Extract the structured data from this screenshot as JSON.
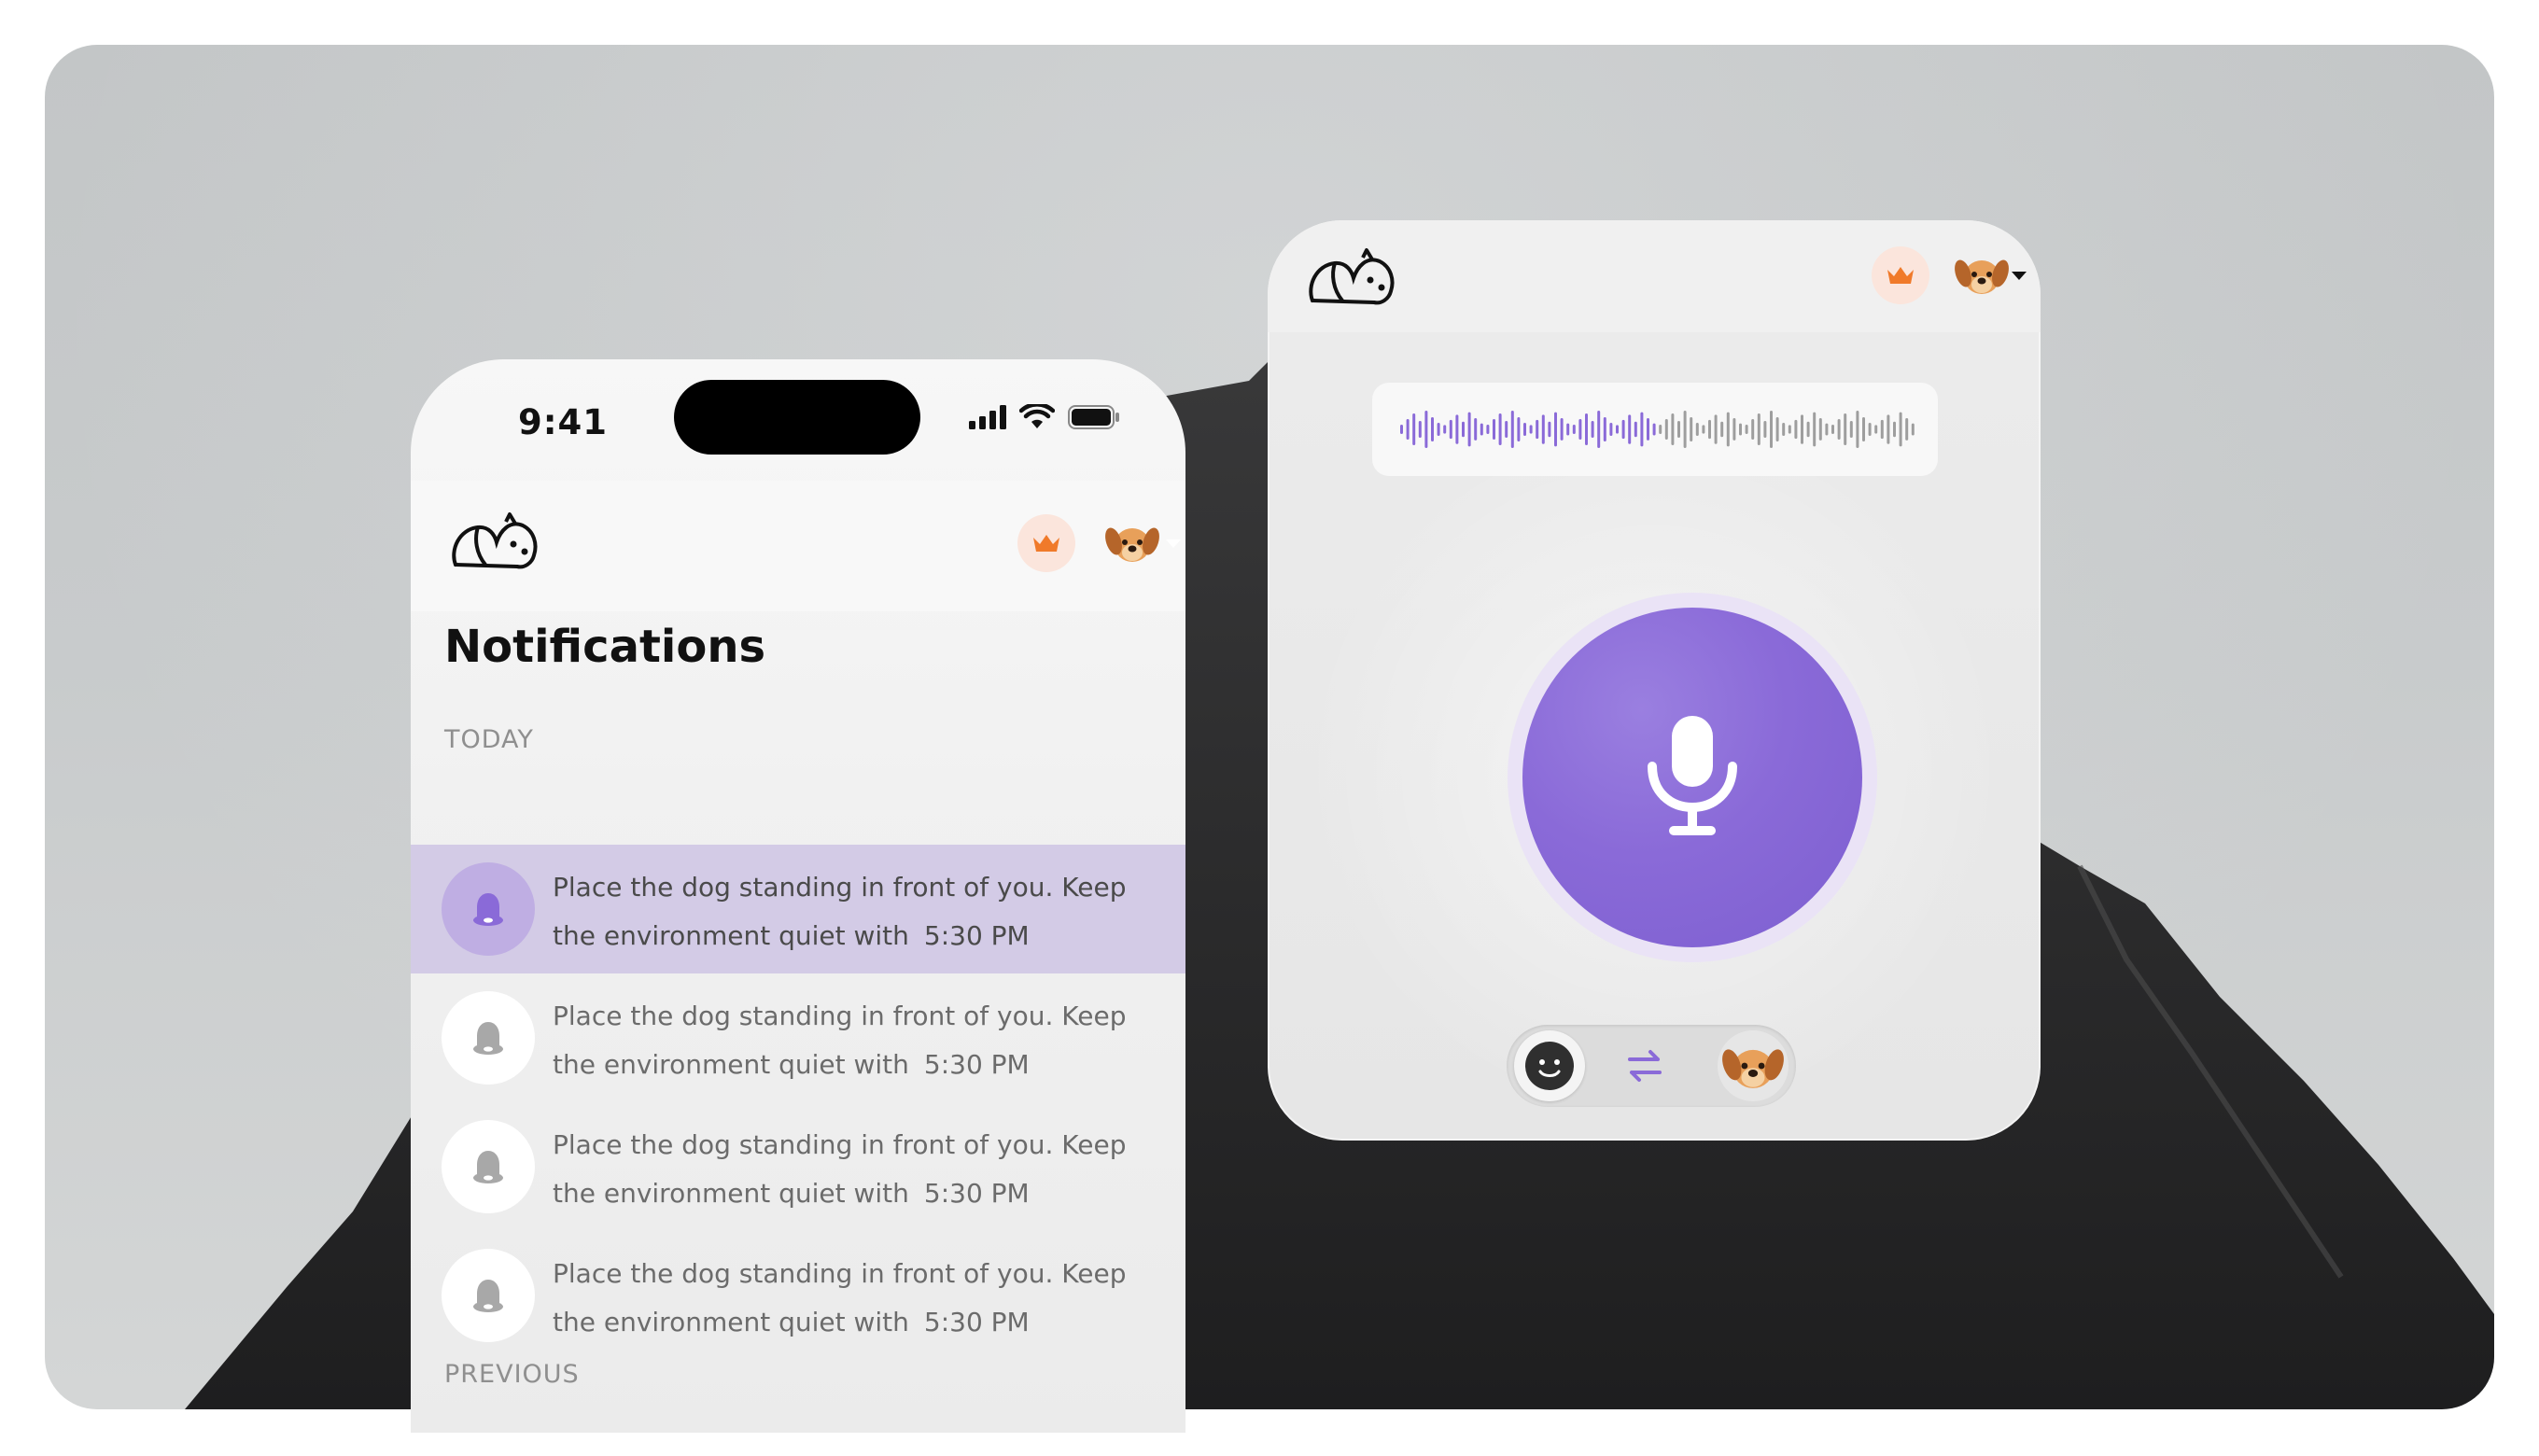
{
  "phone": {
    "status": {
      "time": "9:41"
    },
    "header": {
      "logo_icon": "cat-dog-logo-icon",
      "premium_icon": "crown-icon",
      "avatar_icon": "dog-face-icon"
    },
    "title": "Notifications",
    "sections": {
      "today": "TODAY",
      "previous": "PREVIOUS"
    },
    "notifications": [
      {
        "text": "Place the dog standing in front of you. Keep the environment quiet with",
        "time": "5:30 PM",
        "active": true
      },
      {
        "text": "Place the dog standing in front of you. Keep the environment quiet with",
        "time": "5:30 PM",
        "active": false
      },
      {
        "text": "Place the dog standing in front of you. Keep the environment quiet with",
        "time": "5:30 PM",
        "active": false
      },
      {
        "text": "Place the dog standing in front of you. Keep the environment quiet with",
        "time": "5:30 PM",
        "active": false
      }
    ]
  },
  "voice_card": {
    "header": {
      "logo_icon": "cat-dog-logo-icon",
      "premium_icon": "crown-icon",
      "avatar_icon": "dog-face-icon"
    },
    "waveform_played_fraction": 0.5,
    "mic_icon": "microphone-icon",
    "toggle": {
      "left_icon": "human-face-icon",
      "middle_icon": "swap-arrows-icon",
      "right_icon": "dog-face-icon"
    }
  },
  "colors": {
    "accent_purple": "#8a6ad8",
    "highlight_row": "#d3cbe6",
    "crown_orange": "#f07a2a",
    "crown_bg": "#fbe5dc"
  }
}
